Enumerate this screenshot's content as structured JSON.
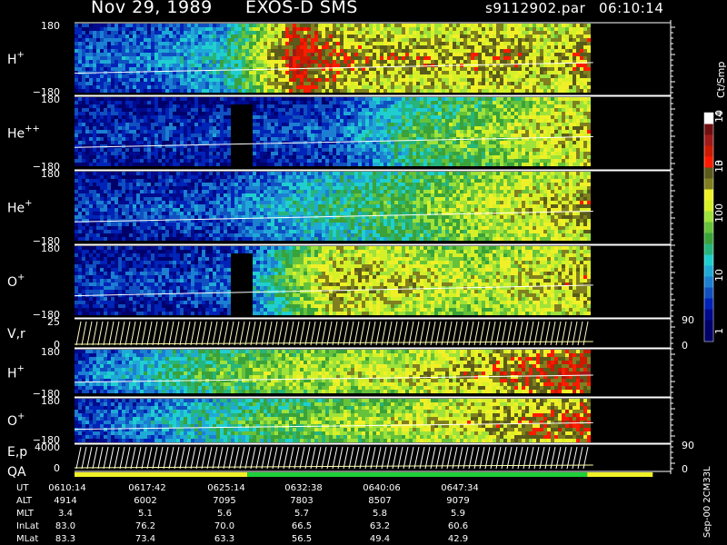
{
  "header": {
    "date": "Nov 29, 1989",
    "mission": "EXOS-D SMS",
    "file": "s9112902.par",
    "time": "06:10:14"
  },
  "colors": {
    "background": "#000000",
    "colorbar": [
      "#000066",
      "#00006b",
      "#000a8c",
      "#0023b8",
      "#1050c0",
      "#1c7fd2",
      "#1fa9d6",
      "#1fcfcf",
      "#26b57a",
      "#3aa23a",
      "#66c23a",
      "#9ee23a",
      "#d6f028",
      "#f0f028",
      "#808020",
      "#5a5a1a",
      "#ff1a00",
      "#cc1a00",
      "#a01a1a",
      "#701010",
      "#ffffff"
    ]
  },
  "chart_data": {
    "type": "heatmap",
    "colorbar": {
      "label": "Ct/Smp",
      "scale": "log",
      "range": [
        1,
        10000
      ],
      "ticks": [
        "1",
        "10",
        "100",
        "10",
        "3",
        "10",
        "4"
      ]
    },
    "panels": [
      {
        "id": "h-plus-top",
        "label": "H",
        "sup": "+",
        "ylim": [
          -180,
          180
        ],
        "ticks": [
          "180",
          "−180"
        ],
        "data_end_fraction": 0.87,
        "intensity_profile": [
          0.18,
          0.22,
          0.25,
          0.28,
          0.35,
          0.62,
          0.9,
          0.78,
          0.74,
          0.73,
          0.72,
          0.75,
          0.73,
          0.7,
          0.78
        ]
      },
      {
        "id": "he-plus-plus",
        "label": "He",
        "sup": "++",
        "ylim": [
          -180,
          180
        ],
        "ticks": [
          "180",
          "−180"
        ],
        "data_end_fraction": 0.87,
        "gap": [
          0.3,
          0.34
        ],
        "intensity_profile": [
          0.14,
          0.14,
          0.15,
          0.15,
          0.16,
          0.16,
          0.17,
          0.2,
          0.3,
          0.45,
          0.5,
          0.55,
          0.62,
          0.68,
          0.72
        ]
      },
      {
        "id": "he-plus",
        "label": "He",
        "sup": "+",
        "ylim": [
          -180,
          180
        ],
        "ticks": [
          "180",
          "−180"
        ],
        "data_end_fraction": 0.87,
        "intensity_profile": [
          0.15,
          0.16,
          0.17,
          0.18,
          0.2,
          0.28,
          0.35,
          0.4,
          0.45,
          0.5,
          0.55,
          0.62,
          0.66,
          0.7,
          0.74
        ]
      },
      {
        "id": "o-plus-top",
        "label": "O",
        "sup": "+",
        "ylim": [
          -180,
          180
        ],
        "ticks": [
          "180",
          "−180"
        ],
        "data_end_fraction": 0.87,
        "gap": [
          0.3,
          0.34
        ],
        "intensity_profile": [
          0.15,
          0.15,
          0.16,
          0.17,
          0.2,
          0.3,
          0.55,
          0.72,
          0.7,
          0.68,
          0.62,
          0.62,
          0.66,
          0.7,
          0.75
        ]
      },
      {
        "id": "v-r",
        "label": "V,r",
        "kind": "line",
        "ylim": [
          0,
          25
        ],
        "ticks": [
          "25",
          "0"
        ],
        "right_ticks": [
          "90",
          "0"
        ],
        "data_end_fraction": 0.87
      },
      {
        "id": "h-plus-bottom",
        "label": "H",
        "sup": "+",
        "ylim": [
          -180,
          180
        ],
        "ticks": [
          "180",
          "−180"
        ],
        "data_end_fraction": 0.87,
        "intensity_profile": [
          0.2,
          0.28,
          0.35,
          0.45,
          0.5,
          0.55,
          0.6,
          0.62,
          0.64,
          0.66,
          0.7,
          0.75,
          0.8,
          0.85,
          0.88
        ]
      },
      {
        "id": "o-plus-bottom",
        "label": "O",
        "sup": "+",
        "ylim": [
          -180,
          180
        ],
        "ticks": [
          "180",
          "−180"
        ],
        "data_end_fraction": 0.87,
        "intensity_profile": [
          0.18,
          0.22,
          0.28,
          0.35,
          0.42,
          0.48,
          0.52,
          0.56,
          0.6,
          0.64,
          0.68,
          0.72,
          0.76,
          0.8,
          0.84
        ]
      },
      {
        "id": "e-p",
        "label": "E,p",
        "kind": "line",
        "ylim": [
          0,
          4000
        ],
        "ticks": [
          "4000",
          "0"
        ],
        "right_ticks": [
          "90",
          "0"
        ],
        "data_end_fraction": 0.87
      }
    ],
    "qa": {
      "label": "QA",
      "segments": [
        {
          "from": 0.0,
          "to": 0.29,
          "color": "#f0f028"
        },
        {
          "from": 0.29,
          "to": 0.86,
          "color": "#1fcf3a"
        },
        {
          "from": 0.86,
          "to": 0.97,
          "color": "#f0f028"
        }
      ]
    },
    "ephemeris": {
      "labels": [
        "UT",
        "ALT",
        "MLT",
        "InLat",
        "MLat"
      ],
      "columns": [
        [
          "0610:14",
          "4914",
          "3.4",
          "83.0",
          "83.3"
        ],
        [
          "0617:42",
          "6002",
          "5.1",
          "76.2",
          "73.4"
        ],
        [
          "0625:14",
          "7095",
          "5.6",
          "70.0",
          "63.3"
        ],
        [
          "0632:38",
          "7803",
          "5.7",
          "66.5",
          "56.5"
        ],
        [
          "0640:06",
          "8507",
          "5.8",
          "63.2",
          "49.4"
        ],
        [
          "0647:34",
          "9079",
          "5.9",
          "60.6",
          "42.9"
        ]
      ]
    },
    "footer_note": "Sep-00 2CM33L"
  }
}
